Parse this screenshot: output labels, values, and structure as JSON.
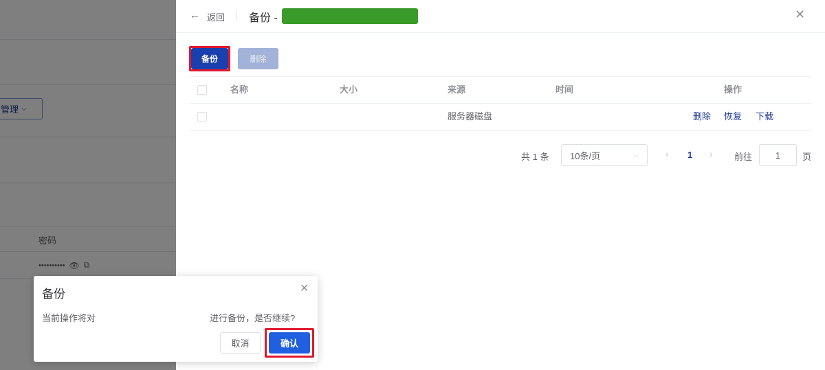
{
  "background": {
    "manage_button": "管理",
    "password_column": "密码",
    "password_value": "••••••••••"
  },
  "drawer": {
    "back_label": "返回",
    "title": "备份 -",
    "toolbar": {
      "backup_label": "备份",
      "delete_label": "删除"
    },
    "table": {
      "headers": [
        "名称",
        "大小",
        "来源",
        "时间",
        "操作"
      ],
      "rows": [
        {
          "name": "",
          "size": "",
          "source": "服务器磁盘",
          "time": "",
          "actions": [
            "删除",
            "恢复",
            "下载"
          ]
        }
      ]
    },
    "pagination": {
      "total": "共 1 条",
      "page_size": "10条/页",
      "current_page": "1",
      "goto_label": "前往",
      "goto_value": "1",
      "page_unit": "页"
    }
  },
  "dialog": {
    "title": "备份",
    "message_prefix": "当前操作将对",
    "message_suffix": "进行备份，是否继续?",
    "cancel_label": "取消",
    "confirm_label": "确认"
  },
  "colors": {
    "primary": "#1a3fae",
    "confirm": "#1f5fe0",
    "highlight": "#e0182c",
    "redaction": "#3a9b2a"
  }
}
